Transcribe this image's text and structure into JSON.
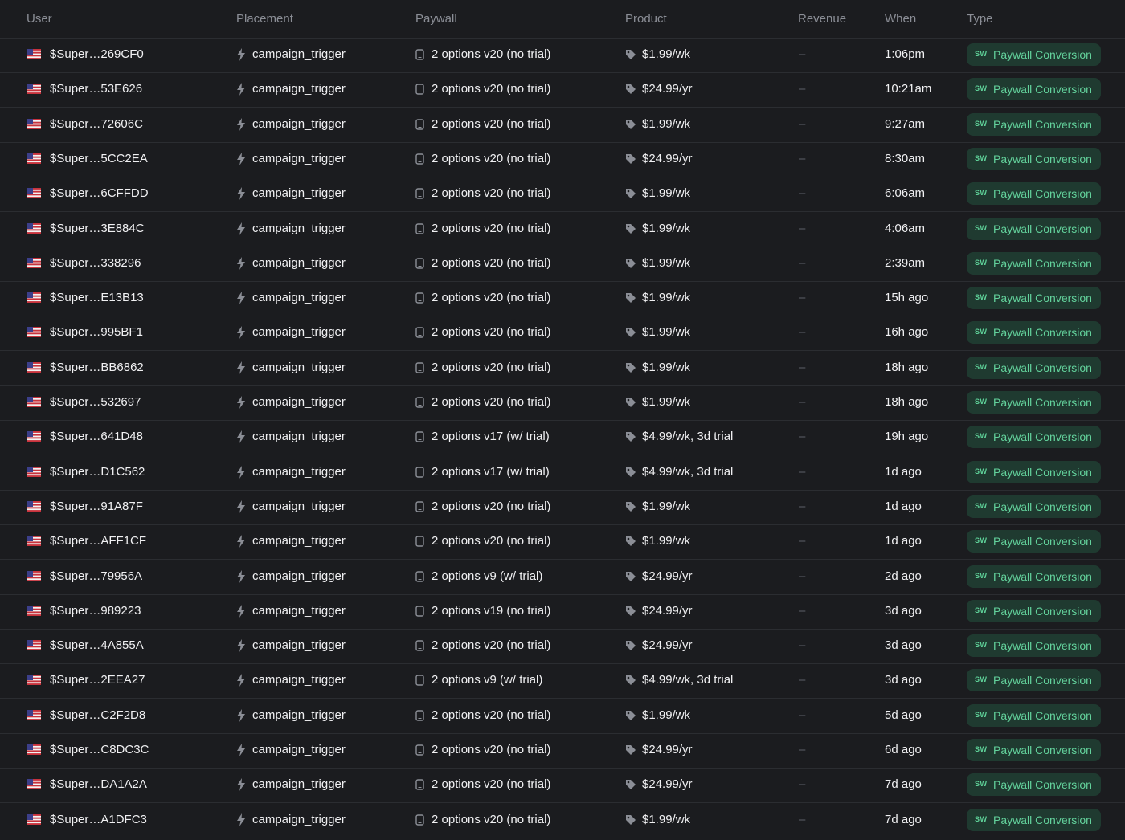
{
  "header": {
    "user": "User",
    "placement": "Placement",
    "paywall": "Paywall",
    "product": "Product",
    "revenue": "Revenue",
    "when": "When",
    "type": "Type"
  },
  "icons": {
    "flag": "us-flag-icon",
    "placement": "lightning-bolt-icon",
    "paywall": "mobile-phone-icon",
    "product": "price-tag-icon",
    "badge": "superwall-logo-icon"
  },
  "colors": {
    "background": "#1b1c1f",
    "row_border": "#2b2d31",
    "badge_bg": "#1f3a30",
    "badge_text": "#63d29c"
  },
  "badge_logo_text": "SW",
  "rows": [
    {
      "user": "$Super…269CF0",
      "placement": "campaign_trigger",
      "paywall": "2 options v20 (no trial)",
      "product": "$1.99/wk",
      "revenue": "–",
      "when": "1:06pm",
      "type": "Paywall Conversion"
    },
    {
      "user": "$Super…53E626",
      "placement": "campaign_trigger",
      "paywall": "2 options v20 (no trial)",
      "product": "$24.99/yr",
      "revenue": "–",
      "when": "10:21am",
      "type": "Paywall Conversion"
    },
    {
      "user": "$Super…72606C",
      "placement": "campaign_trigger",
      "paywall": "2 options v20 (no trial)",
      "product": "$1.99/wk",
      "revenue": "–",
      "when": "9:27am",
      "type": "Paywall Conversion"
    },
    {
      "user": "$Super…5CC2EA",
      "placement": "campaign_trigger",
      "paywall": "2 options v20 (no trial)",
      "product": "$24.99/yr",
      "revenue": "–",
      "when": "8:30am",
      "type": "Paywall Conversion"
    },
    {
      "user": "$Super…6CFFDD",
      "placement": "campaign_trigger",
      "paywall": "2 options v20 (no trial)",
      "product": "$1.99/wk",
      "revenue": "–",
      "when": "6:06am",
      "type": "Paywall Conversion"
    },
    {
      "user": "$Super…3E884C",
      "placement": "campaign_trigger",
      "paywall": "2 options v20 (no trial)",
      "product": "$1.99/wk",
      "revenue": "–",
      "when": "4:06am",
      "type": "Paywall Conversion"
    },
    {
      "user": "$Super…338296",
      "placement": "campaign_trigger",
      "paywall": "2 options v20 (no trial)",
      "product": "$1.99/wk",
      "revenue": "–",
      "when": "2:39am",
      "type": "Paywall Conversion"
    },
    {
      "user": "$Super…E13B13",
      "placement": "campaign_trigger",
      "paywall": "2 options v20 (no trial)",
      "product": "$1.99/wk",
      "revenue": "–",
      "when": "15h ago",
      "type": "Paywall Conversion"
    },
    {
      "user": "$Super…995BF1",
      "placement": "campaign_trigger",
      "paywall": "2 options v20 (no trial)",
      "product": "$1.99/wk",
      "revenue": "–",
      "when": "16h ago",
      "type": "Paywall Conversion"
    },
    {
      "user": "$Super…BB6862",
      "placement": "campaign_trigger",
      "paywall": "2 options v20 (no trial)",
      "product": "$1.99/wk",
      "revenue": "–",
      "when": "18h ago",
      "type": "Paywall Conversion"
    },
    {
      "user": "$Super…532697",
      "placement": "campaign_trigger",
      "paywall": "2 options v20 (no trial)",
      "product": "$1.99/wk",
      "revenue": "–",
      "when": "18h ago",
      "type": "Paywall Conversion"
    },
    {
      "user": "$Super…641D48",
      "placement": "campaign_trigger",
      "paywall": "2 options v17 (w/ trial)",
      "product": "$4.99/wk, 3d trial",
      "revenue": "–",
      "when": "19h ago",
      "type": "Paywall Conversion"
    },
    {
      "user": "$Super…D1C562",
      "placement": "campaign_trigger",
      "paywall": "2 options v17 (w/ trial)",
      "product": "$4.99/wk, 3d trial",
      "revenue": "–",
      "when": "1d ago",
      "type": "Paywall Conversion"
    },
    {
      "user": "$Super…91A87F",
      "placement": "campaign_trigger",
      "paywall": "2 options v20 (no trial)",
      "product": "$1.99/wk",
      "revenue": "–",
      "when": "1d ago",
      "type": "Paywall Conversion"
    },
    {
      "user": "$Super…AFF1CF",
      "placement": "campaign_trigger",
      "paywall": "2 options v20 (no trial)",
      "product": "$1.99/wk",
      "revenue": "–",
      "when": "1d ago",
      "type": "Paywall Conversion"
    },
    {
      "user": "$Super…79956A",
      "placement": "campaign_trigger",
      "paywall": "2 options v9 (w/ trial)",
      "product": "$24.99/yr",
      "revenue": "–",
      "when": "2d ago",
      "type": "Paywall Conversion"
    },
    {
      "user": "$Super…989223",
      "placement": "campaign_trigger",
      "paywall": "2 options v19 (no trial)",
      "product": "$24.99/yr",
      "revenue": "–",
      "when": "3d ago",
      "type": "Paywall Conversion"
    },
    {
      "user": "$Super…4A855A",
      "placement": "campaign_trigger",
      "paywall": "2 options v20 (no trial)",
      "product": "$24.99/yr",
      "revenue": "–",
      "when": "3d ago",
      "type": "Paywall Conversion"
    },
    {
      "user": "$Super…2EEA27",
      "placement": "campaign_trigger",
      "paywall": "2 options v9 (w/ trial)",
      "product": "$4.99/wk, 3d trial",
      "revenue": "–",
      "when": "3d ago",
      "type": "Paywall Conversion"
    },
    {
      "user": "$Super…C2F2D8",
      "placement": "campaign_trigger",
      "paywall": "2 options v20 (no trial)",
      "product": "$1.99/wk",
      "revenue": "–",
      "when": "5d ago",
      "type": "Paywall Conversion"
    },
    {
      "user": "$Super…C8DC3C",
      "placement": "campaign_trigger",
      "paywall": "2 options v20 (no trial)",
      "product": "$24.99/yr",
      "revenue": "–",
      "when": "6d ago",
      "type": "Paywall Conversion"
    },
    {
      "user": "$Super…DA1A2A",
      "placement": "campaign_trigger",
      "paywall": "2 options v20 (no trial)",
      "product": "$24.99/yr",
      "revenue": "–",
      "when": "7d ago",
      "type": "Paywall Conversion"
    },
    {
      "user": "$Super…A1DFC3",
      "placement": "campaign_trigger",
      "paywall": "2 options v20 (no trial)",
      "product": "$1.99/wk",
      "revenue": "–",
      "when": "7d ago",
      "type": "Paywall Conversion"
    }
  ]
}
